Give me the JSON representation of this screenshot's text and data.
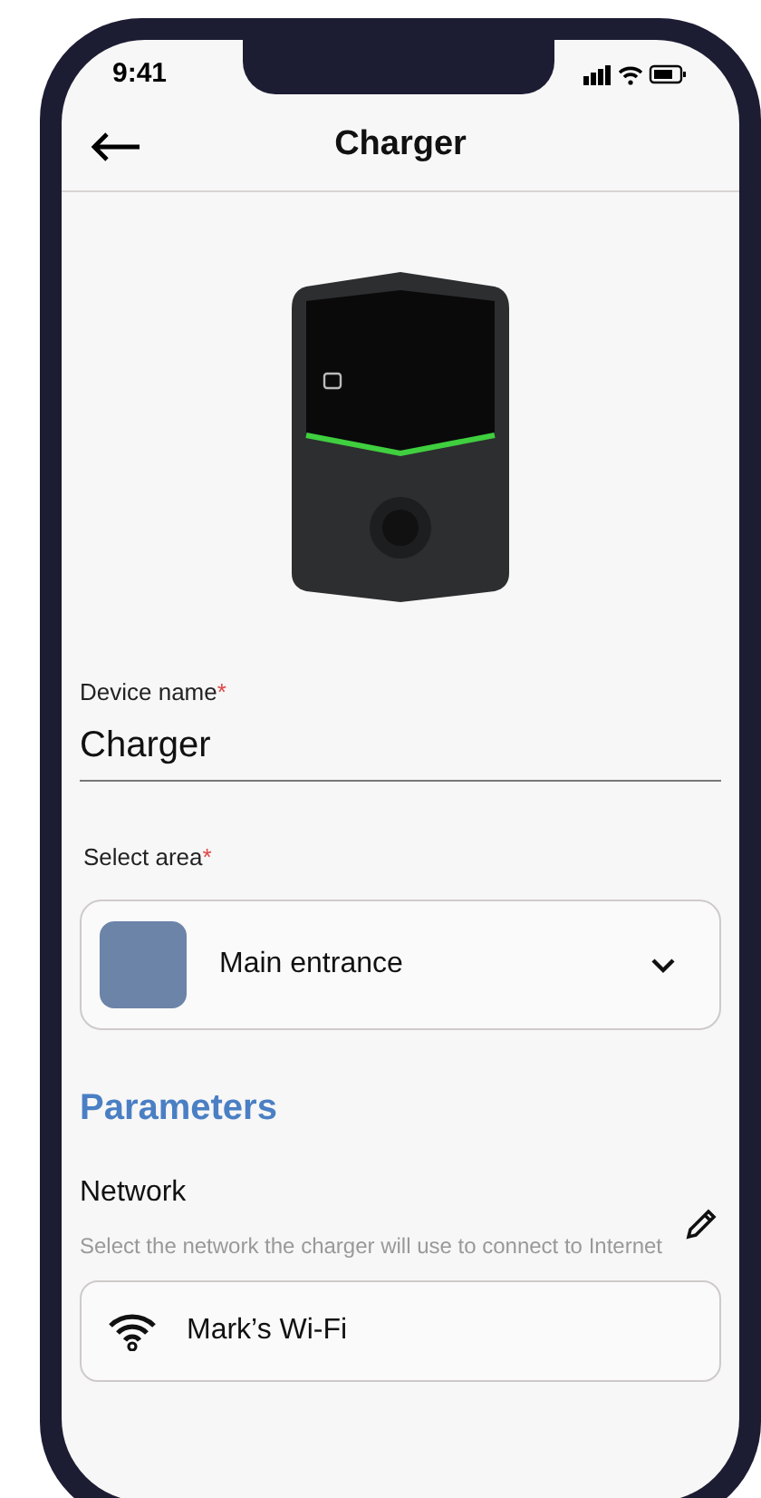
{
  "status_bar": {
    "time": "9:41"
  },
  "header": {
    "title": "Charger"
  },
  "device_name": {
    "label": "Device name",
    "required_mark": "*",
    "value": "Charger"
  },
  "area": {
    "label": "Select area",
    "required_mark": "*",
    "value": "Main entrance"
  },
  "parameters": {
    "title": "Parameters",
    "network": {
      "title": "Network",
      "description": "Select the network the charger will use to connect to Internet",
      "value": "Mark’s Wi-Fi"
    }
  }
}
